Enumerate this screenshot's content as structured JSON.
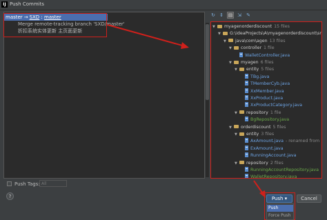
{
  "window": {
    "app_icon": "IJ",
    "title": "Push Commits"
  },
  "commits": {
    "header": {
      "local_branch": "master",
      "arrow": "→",
      "remote": "SXD",
      "separator": " : ",
      "remote_branch": "master"
    },
    "messages": [
      "Merge remote-tracking branch 'SXD/master'",
      "折扣系统实体更新 主页面更新"
    ]
  },
  "toolbar": {
    "icons": [
      "refresh-icon",
      "expand-all-icon",
      "group-by-directory-icon",
      "collapse-icon",
      "show-diff-icon"
    ]
  },
  "tree": {
    "rows": [
      {
        "kind": "dir",
        "expanded": true,
        "indent": 0,
        "name": "myagenorderdiscount",
        "count": "15 files",
        "style": "dir"
      },
      {
        "kind": "dir",
        "expanded": true,
        "indent": 1,
        "name": "G:\\ideaProjects\\A\\myagenorderdiscount\\src\\",
        "count": "",
        "style": "dir"
      },
      {
        "kind": "dir",
        "expanded": true,
        "indent": 2,
        "name": "java\\com\\agen",
        "count": "13 files",
        "style": "dir"
      },
      {
        "kind": "dir",
        "expanded": true,
        "indent": 3,
        "name": "controller",
        "count": "1 file",
        "style": "dir"
      },
      {
        "kind": "file",
        "indent": 4,
        "name": "WalletController.java",
        "count": "",
        "style": "file"
      },
      {
        "kind": "dir",
        "expanded": true,
        "indent": 3,
        "name": "myagen",
        "count": "6 files",
        "style": "dir"
      },
      {
        "kind": "dir",
        "expanded": true,
        "indent": 4,
        "name": "entity",
        "count": "5 files",
        "style": "dir"
      },
      {
        "kind": "file",
        "indent": 5,
        "name": "TBg.java",
        "count": "",
        "style": "file"
      },
      {
        "kind": "file",
        "indent": 5,
        "name": "TMemberCyb.java",
        "count": "",
        "style": "file"
      },
      {
        "kind": "file",
        "indent": 5,
        "name": "XxMember.java",
        "count": "",
        "style": "file"
      },
      {
        "kind": "file",
        "indent": 5,
        "name": "XxProduct.java",
        "count": "",
        "style": "file"
      },
      {
        "kind": "file",
        "indent": 5,
        "name": "XxProductCategory.java",
        "count": "",
        "style": "file"
      },
      {
        "kind": "dir",
        "expanded": true,
        "indent": 4,
        "name": "repository",
        "count": "1 file",
        "style": "dir"
      },
      {
        "kind": "file",
        "indent": 5,
        "name": "BgRepository.java",
        "count": "",
        "style": "green"
      },
      {
        "kind": "dir",
        "expanded": true,
        "indent": 3,
        "name": "orderdiscount",
        "count": "5 files",
        "style": "dir"
      },
      {
        "kind": "dir",
        "expanded": true,
        "indent": 4,
        "name": "entity",
        "count": "3 files",
        "style": "dir"
      },
      {
        "kind": "file",
        "indent": 5,
        "name": "AxAmount.java",
        "count": "- renamed from",
        "style": "file"
      },
      {
        "kind": "file",
        "indent": 5,
        "name": "ExAmount.java",
        "count": "",
        "style": "file"
      },
      {
        "kind": "file",
        "indent": 5,
        "name": "RunningAccount.java",
        "count": "",
        "style": "file"
      },
      {
        "kind": "dir",
        "expanded": true,
        "indent": 4,
        "name": "repository",
        "count": "2 files",
        "style": "dir"
      },
      {
        "kind": "file",
        "indent": 5,
        "name": "RunningAccountRepository.java",
        "count": "",
        "style": "green"
      },
      {
        "kind": "file",
        "indent": 5,
        "name": "WalletRepository.java",
        "count": "",
        "style": "green"
      }
    ]
  },
  "bottom": {
    "push_tags_label": "Push Tags:",
    "tags_value": "All",
    "help_label": "?",
    "push_button": "Push",
    "push_caret": "▾",
    "cancel_button": "Cancel",
    "dropdown_items": [
      "Push",
      "Force Push"
    ]
  },
  "colors": {
    "annotation": "#d0201b",
    "selection": "#4b6eaf",
    "push_button": "#365880"
  }
}
